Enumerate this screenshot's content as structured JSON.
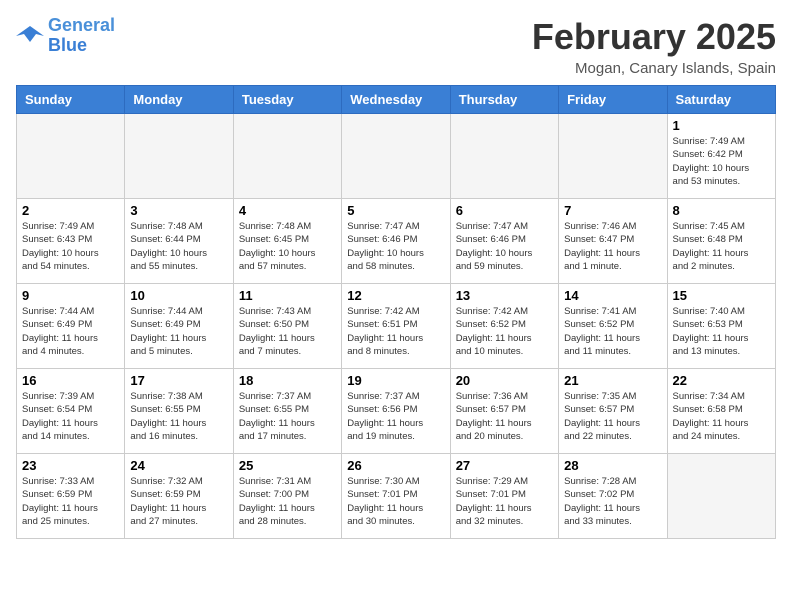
{
  "logo": {
    "line1": "General",
    "line2": "Blue"
  },
  "title": "February 2025",
  "location": "Mogan, Canary Islands, Spain",
  "days_of_week": [
    "Sunday",
    "Monday",
    "Tuesday",
    "Wednesday",
    "Thursday",
    "Friday",
    "Saturday"
  ],
  "weeks": [
    [
      {
        "day": "",
        "info": ""
      },
      {
        "day": "",
        "info": ""
      },
      {
        "day": "",
        "info": ""
      },
      {
        "day": "",
        "info": ""
      },
      {
        "day": "",
        "info": ""
      },
      {
        "day": "",
        "info": ""
      },
      {
        "day": "1",
        "info": "Sunrise: 7:49 AM\nSunset: 6:42 PM\nDaylight: 10 hours\nand 53 minutes."
      }
    ],
    [
      {
        "day": "2",
        "info": "Sunrise: 7:49 AM\nSunset: 6:43 PM\nDaylight: 10 hours\nand 54 minutes."
      },
      {
        "day": "3",
        "info": "Sunrise: 7:48 AM\nSunset: 6:44 PM\nDaylight: 10 hours\nand 55 minutes."
      },
      {
        "day": "4",
        "info": "Sunrise: 7:48 AM\nSunset: 6:45 PM\nDaylight: 10 hours\nand 57 minutes."
      },
      {
        "day": "5",
        "info": "Sunrise: 7:47 AM\nSunset: 6:46 PM\nDaylight: 10 hours\nand 58 minutes."
      },
      {
        "day": "6",
        "info": "Sunrise: 7:47 AM\nSunset: 6:46 PM\nDaylight: 10 hours\nand 59 minutes."
      },
      {
        "day": "7",
        "info": "Sunrise: 7:46 AM\nSunset: 6:47 PM\nDaylight: 11 hours\nand 1 minute."
      },
      {
        "day": "8",
        "info": "Sunrise: 7:45 AM\nSunset: 6:48 PM\nDaylight: 11 hours\nand 2 minutes."
      }
    ],
    [
      {
        "day": "9",
        "info": "Sunrise: 7:44 AM\nSunset: 6:49 PM\nDaylight: 11 hours\nand 4 minutes."
      },
      {
        "day": "10",
        "info": "Sunrise: 7:44 AM\nSunset: 6:49 PM\nDaylight: 11 hours\nand 5 minutes."
      },
      {
        "day": "11",
        "info": "Sunrise: 7:43 AM\nSunset: 6:50 PM\nDaylight: 11 hours\nand 7 minutes."
      },
      {
        "day": "12",
        "info": "Sunrise: 7:42 AM\nSunset: 6:51 PM\nDaylight: 11 hours\nand 8 minutes."
      },
      {
        "day": "13",
        "info": "Sunrise: 7:42 AM\nSunset: 6:52 PM\nDaylight: 11 hours\nand 10 minutes."
      },
      {
        "day": "14",
        "info": "Sunrise: 7:41 AM\nSunset: 6:52 PM\nDaylight: 11 hours\nand 11 minutes."
      },
      {
        "day": "15",
        "info": "Sunrise: 7:40 AM\nSunset: 6:53 PM\nDaylight: 11 hours\nand 13 minutes."
      }
    ],
    [
      {
        "day": "16",
        "info": "Sunrise: 7:39 AM\nSunset: 6:54 PM\nDaylight: 11 hours\nand 14 minutes."
      },
      {
        "day": "17",
        "info": "Sunrise: 7:38 AM\nSunset: 6:55 PM\nDaylight: 11 hours\nand 16 minutes."
      },
      {
        "day": "18",
        "info": "Sunrise: 7:37 AM\nSunset: 6:55 PM\nDaylight: 11 hours\nand 17 minutes."
      },
      {
        "day": "19",
        "info": "Sunrise: 7:37 AM\nSunset: 6:56 PM\nDaylight: 11 hours\nand 19 minutes."
      },
      {
        "day": "20",
        "info": "Sunrise: 7:36 AM\nSunset: 6:57 PM\nDaylight: 11 hours\nand 20 minutes."
      },
      {
        "day": "21",
        "info": "Sunrise: 7:35 AM\nSunset: 6:57 PM\nDaylight: 11 hours\nand 22 minutes."
      },
      {
        "day": "22",
        "info": "Sunrise: 7:34 AM\nSunset: 6:58 PM\nDaylight: 11 hours\nand 24 minutes."
      }
    ],
    [
      {
        "day": "23",
        "info": "Sunrise: 7:33 AM\nSunset: 6:59 PM\nDaylight: 11 hours\nand 25 minutes."
      },
      {
        "day": "24",
        "info": "Sunrise: 7:32 AM\nSunset: 6:59 PM\nDaylight: 11 hours\nand 27 minutes."
      },
      {
        "day": "25",
        "info": "Sunrise: 7:31 AM\nSunset: 7:00 PM\nDaylight: 11 hours\nand 28 minutes."
      },
      {
        "day": "26",
        "info": "Sunrise: 7:30 AM\nSunset: 7:01 PM\nDaylight: 11 hours\nand 30 minutes."
      },
      {
        "day": "27",
        "info": "Sunrise: 7:29 AM\nSunset: 7:01 PM\nDaylight: 11 hours\nand 32 minutes."
      },
      {
        "day": "28",
        "info": "Sunrise: 7:28 AM\nSunset: 7:02 PM\nDaylight: 11 hours\nand 33 minutes."
      },
      {
        "day": "",
        "info": ""
      }
    ]
  ]
}
